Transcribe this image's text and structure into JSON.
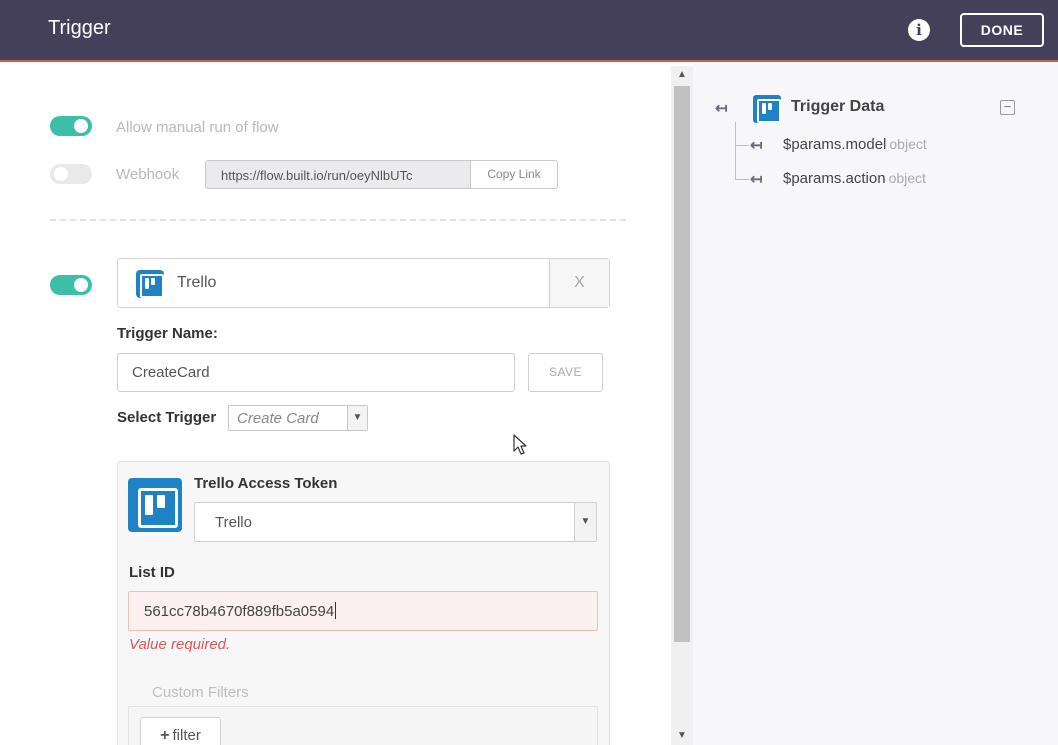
{
  "header": {
    "title": "Trigger",
    "info_icon": "i",
    "done_label": "DONE"
  },
  "settings": {
    "manual_run_label": "Allow manual run of flow",
    "manual_run_enabled": true,
    "webhook_label": "Webhook",
    "webhook_enabled": false,
    "webhook_url": "https://flow.built.io/run/oeyNlbUTc",
    "copy_link_label": "Copy Link"
  },
  "service": {
    "enabled": true,
    "name": "Trello",
    "close_label": "X"
  },
  "trigger_name": {
    "label": "Trigger Name:",
    "value": "CreateCard",
    "save_label": "SAVE"
  },
  "select_trigger": {
    "label": "Select Trigger",
    "value": "Create Card"
  },
  "config": {
    "token_label": "Trello Access Token",
    "token_value": "Trello",
    "list_id_label": "List ID",
    "list_id_value": "561cc78b4670f889fb5a0594",
    "error_message": "Value required.",
    "custom_filters_label": "Custom Filters",
    "filter_button_label": "filter"
  },
  "trigger_data": {
    "title": "Trigger Data",
    "collapse_symbol": "−",
    "items": [
      {
        "name": "$params.model",
        "type": "object"
      },
      {
        "name": "$params.action",
        "type": "object"
      }
    ]
  },
  "colors": {
    "header_bg": "#45405a",
    "accent_red": "#d9534f",
    "toggle_on": "#3cbfa7",
    "trello_blue": "#1e82c5",
    "error": "#e05555"
  },
  "icons": [
    "info-icon",
    "trello-icon",
    "close-icon",
    "chevron-down-icon",
    "plus-icon",
    "tree-node-icon",
    "collapse-icon",
    "mouse-pointer-icon"
  ]
}
